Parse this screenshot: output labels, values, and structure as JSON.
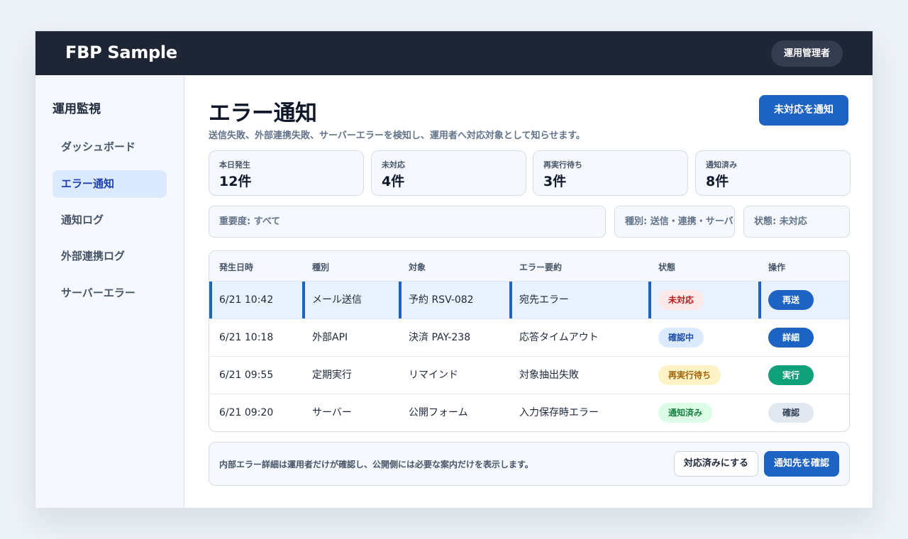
{
  "header": {
    "brand": "FBP Sample",
    "role": "運用管理者"
  },
  "sidebar": {
    "heading": "運用監視",
    "items": [
      {
        "label": "ダッシュボード",
        "active": false
      },
      {
        "label": "エラー通知",
        "active": true
      },
      {
        "label": "通知ログ",
        "active": false
      },
      {
        "label": "外部連携ログ",
        "active": false
      },
      {
        "label": "サーバーエラー",
        "active": false
      }
    ]
  },
  "main": {
    "title": "エラー通知",
    "subtitle": "送信失敗、外部連携失敗、サーバーエラーを検知し、運用者へ対応対象として知らせます。",
    "notify_button": "未対応を通知",
    "stats": [
      {
        "label": "本日発生",
        "value": "12件"
      },
      {
        "label": "未対応",
        "value": "4件"
      },
      {
        "label": "再実行待ち",
        "value": "3件"
      },
      {
        "label": "通知済み",
        "value": "8件"
      }
    ],
    "filters": {
      "severity": "重要度: すべて",
      "type": "種別: 送信・連携・サーバー",
      "status": "状態: 未対応"
    },
    "table": {
      "columns": [
        "発生日時",
        "種別",
        "対象",
        "エラー要約",
        "状態",
        "操作"
      ],
      "rows": [
        {
          "datetime": "6/21 10:42",
          "type": "メール送信",
          "target": "予約 RSV-082",
          "summary": "宛先エラー",
          "status": "未対応",
          "action": "再送"
        },
        {
          "datetime": "6/21 10:18",
          "type": "外部API",
          "target": "決済 PAY-238",
          "summary": "応答タイムアウト",
          "status": "確認中",
          "action": "詳細"
        },
        {
          "datetime": "6/21 09:55",
          "type": "定期実行",
          "target": "リマインド",
          "summary": "対象抽出失敗",
          "status": "再実行待ち",
          "action": "実行"
        },
        {
          "datetime": "6/21 09:20",
          "type": "サーバー",
          "target": "公開フォーム",
          "summary": "入力保存時エラー",
          "status": "通知済み",
          "action": "確認"
        }
      ]
    },
    "footer": {
      "note": "内部エラー詳細は運用者だけが確認し、公開側には必要な案内だけを表示します。",
      "resolve_button": "対応済みにする",
      "check_button": "通知先を確認"
    }
  },
  "colors": {
    "topbar": "#1e2636",
    "accent": "#1d63c4",
    "success": "#10a07a",
    "danger": "#b91c1c",
    "warning": "#a16207"
  }
}
